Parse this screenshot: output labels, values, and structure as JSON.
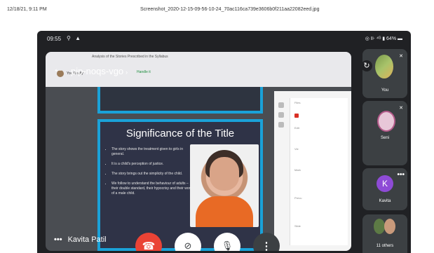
{
  "print_header": {
    "date": "12/18/21, 9:11 PM",
    "filename": "Screenshot_2020-12-15-09-56-10-24_70ac116ca739e3606b0f211aa22082eed.jpg"
  },
  "status_bar": {
    "time": "09:55",
    "left_icons": "⚲ ▲",
    "right": "◎ ⊪ ⁴ᴳ ▮ 64% ▬"
  },
  "meeting": {
    "code": "pip-noqs-vgo",
    "chevron": "›",
    "back_icon": "←"
  },
  "shared_screen": {
    "title": "Analysis of the Stories Prescribed in the Syllabus",
    "owner": "You Really",
    "mini_tag": "Handle it",
    "side_panel_lines": [
      "Files",
      "Edit",
      "Vie",
      "Mark",
      "Prevu",
      "Slide"
    ]
  },
  "slide": {
    "title": "Significance of the Title",
    "bullets": [
      "The story shows the treatment given to girls in general.",
      "It is a child's perception of justice.",
      "The story brings out the simplicity of the child.",
      "We follow to understand the behaviour of adults – their double standard, their hypocrisy and their world of a male child."
    ]
  },
  "presenter": {
    "dots": "•••",
    "name": "Kavita Patil"
  },
  "controls": {
    "end_call_icon": "☎",
    "camera_off_icon": "⊘",
    "mic_off_icon": "🎙",
    "more_icon": "⋮"
  },
  "participants": [
    {
      "label": "You",
      "flip_icon": "↻",
      "mute_icon": "✕"
    },
    {
      "label": "Seni",
      "mute_icon": "✕"
    },
    {
      "label": "Kavita",
      "initial": "K",
      "more_icon": "•••"
    },
    {
      "label": "11 others"
    }
  ],
  "colors": {
    "slide_border": "#1aa2d8",
    "end_call": "#ea4335",
    "kavita_avatar": "#8e4bd6",
    "app_bg": "#202124"
  }
}
